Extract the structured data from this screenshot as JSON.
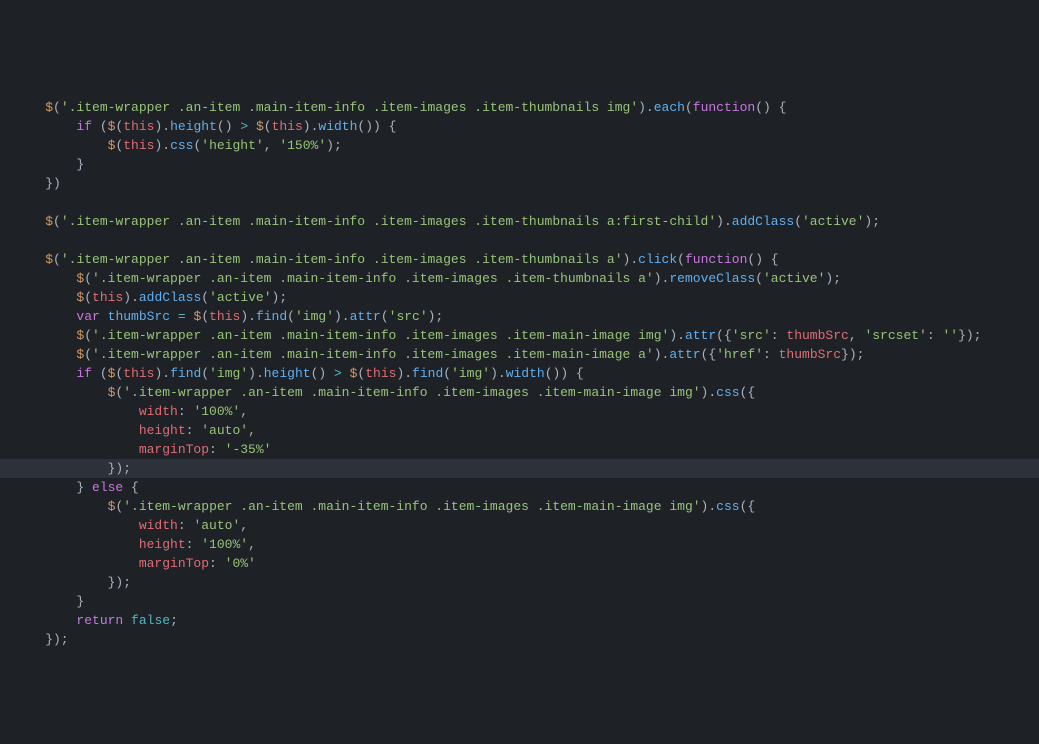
{
  "file": {
    "language": "javascript",
    "highlighted_line_index": 23
  },
  "code": {
    "tokens": [
      [
        [
          "w",
          "    $"
        ],
        [
          "p",
          "("
        ],
        [
          "s",
          "'.item-wrapper .an-item .main-item-info .item-images .item-thumbnails img'"
        ],
        [
          "p",
          ")."
        ],
        [
          "f",
          "each"
        ],
        [
          "p",
          "("
        ],
        [
          "k",
          "function"
        ],
        [
          "p",
          "() {"
        ]
      ],
      [
        [
          "p",
          "        "
        ],
        [
          "k",
          "if"
        ],
        [
          "p",
          " ("
        ],
        [
          "w",
          "$"
        ],
        [
          "p",
          "("
        ],
        [
          "v",
          "this"
        ],
        [
          "p",
          ")."
        ],
        [
          "f",
          "height"
        ],
        [
          "p",
          "() "
        ],
        [
          "o",
          ">"
        ],
        [
          "p",
          " "
        ],
        [
          "w",
          "$"
        ],
        [
          "p",
          "("
        ],
        [
          "v",
          "this"
        ],
        [
          "p",
          ")."
        ],
        [
          "f",
          "width"
        ],
        [
          "p",
          "()) {"
        ]
      ],
      [
        [
          "p",
          "            "
        ],
        [
          "w",
          "$"
        ],
        [
          "p",
          "("
        ],
        [
          "v",
          "this"
        ],
        [
          "p",
          ")."
        ],
        [
          "f",
          "css"
        ],
        [
          "p",
          "("
        ],
        [
          "s",
          "'height'"
        ],
        [
          "p",
          ", "
        ],
        [
          "s",
          "'150%'"
        ],
        [
          "p",
          ");"
        ]
      ],
      [
        [
          "p",
          "        }"
        ]
      ],
      [
        [
          "p",
          "    })"
        ]
      ],
      [
        [
          "p",
          ""
        ]
      ],
      [
        [
          "p",
          "    "
        ],
        [
          "w",
          "$"
        ],
        [
          "p",
          "("
        ],
        [
          "s",
          "'.item-wrapper .an-item .main-item-info .item-images .item-thumbnails a:first-child'"
        ],
        [
          "p",
          ")."
        ],
        [
          "f",
          "addClass"
        ],
        [
          "p",
          "("
        ],
        [
          "s",
          "'active'"
        ],
        [
          "p",
          ");"
        ]
      ],
      [
        [
          "p",
          ""
        ]
      ],
      [
        [
          "p",
          "    "
        ],
        [
          "w",
          "$"
        ],
        [
          "p",
          "("
        ],
        [
          "s",
          "'.item-wrapper .an-item .main-item-info .item-images .item-thumbnails a'"
        ],
        [
          "p",
          ")."
        ],
        [
          "f",
          "click"
        ],
        [
          "p",
          "("
        ],
        [
          "k",
          "function"
        ],
        [
          "p",
          "() {"
        ]
      ],
      [
        [
          "p",
          "        "
        ],
        [
          "w",
          "$"
        ],
        [
          "p",
          "("
        ],
        [
          "s",
          "'.item-wrapper .an-item .main-item-info .item-images .item-thumbnails a'"
        ],
        [
          "p",
          ")."
        ],
        [
          "f",
          "removeClass"
        ],
        [
          "p",
          "("
        ],
        [
          "s",
          "'active'"
        ],
        [
          "p",
          ");"
        ]
      ],
      [
        [
          "p",
          "        "
        ],
        [
          "w",
          "$"
        ],
        [
          "p",
          "("
        ],
        [
          "v",
          "this"
        ],
        [
          "p",
          ")."
        ],
        [
          "f",
          "addClass"
        ],
        [
          "p",
          "("
        ],
        [
          "s",
          "'active'"
        ],
        [
          "p",
          ");"
        ]
      ],
      [
        [
          "p",
          "        "
        ],
        [
          "k",
          "var"
        ],
        [
          "p",
          " "
        ],
        [
          "f",
          "thumbSrc"
        ],
        [
          "p",
          " "
        ],
        [
          "o",
          "="
        ],
        [
          "p",
          " "
        ],
        [
          "w",
          "$"
        ],
        [
          "p",
          "("
        ],
        [
          "v",
          "this"
        ],
        [
          "p",
          ")."
        ],
        [
          "f",
          "find"
        ],
        [
          "p",
          "("
        ],
        [
          "s",
          "'img'"
        ],
        [
          "p",
          ")."
        ],
        [
          "f",
          "attr"
        ],
        [
          "p",
          "("
        ],
        [
          "s",
          "'src'"
        ],
        [
          "p",
          ");"
        ]
      ],
      [
        [
          "p",
          "        "
        ],
        [
          "w",
          "$"
        ],
        [
          "p",
          "("
        ],
        [
          "s",
          "'.item-wrapper .an-item .main-item-info .item-images .item-main-image img'"
        ],
        [
          "p",
          ")."
        ],
        [
          "f",
          "attr"
        ],
        [
          "p",
          "({"
        ],
        [
          "s",
          "'src'"
        ],
        [
          "p",
          ": "
        ],
        [
          "v",
          "thumbSrc"
        ],
        [
          "p",
          ", "
        ],
        [
          "s",
          "'srcset'"
        ],
        [
          "p",
          ": "
        ],
        [
          "s",
          "''"
        ],
        [
          "p",
          "});"
        ]
      ],
      [
        [
          "p",
          "        "
        ],
        [
          "w",
          "$"
        ],
        [
          "p",
          "("
        ],
        [
          "s",
          "'.item-wrapper .an-item .main-item-info .item-images .item-main-image a'"
        ],
        [
          "p",
          ")."
        ],
        [
          "f",
          "attr"
        ],
        [
          "p",
          "({"
        ],
        [
          "s",
          "'href'"
        ],
        [
          "p",
          ": "
        ],
        [
          "v",
          "thumbSrc"
        ],
        [
          "p",
          "});"
        ]
      ],
      [
        [
          "p",
          "        "
        ],
        [
          "k",
          "if"
        ],
        [
          "p",
          " ("
        ],
        [
          "w",
          "$"
        ],
        [
          "p",
          "("
        ],
        [
          "v",
          "this"
        ],
        [
          "p",
          ")."
        ],
        [
          "f",
          "find"
        ],
        [
          "p",
          "("
        ],
        [
          "s",
          "'img'"
        ],
        [
          "p",
          ")."
        ],
        [
          "f",
          "height"
        ],
        [
          "p",
          "() "
        ],
        [
          "o",
          ">"
        ],
        [
          "p",
          " "
        ],
        [
          "w",
          "$"
        ],
        [
          "p",
          "("
        ],
        [
          "v",
          "this"
        ],
        [
          "p",
          ")."
        ],
        [
          "f",
          "find"
        ],
        [
          "p",
          "("
        ],
        [
          "s",
          "'img'"
        ],
        [
          "p",
          ")."
        ],
        [
          "f",
          "width"
        ],
        [
          "p",
          "()) {"
        ]
      ],
      [
        [
          "p",
          "            "
        ],
        [
          "w",
          "$"
        ],
        [
          "p",
          "("
        ],
        [
          "s",
          "'.item-wrapper .an-item .main-item-info .item-images .item-main-image img'"
        ],
        [
          "p",
          ")."
        ],
        [
          "f",
          "css"
        ],
        [
          "p",
          "({"
        ]
      ],
      [
        [
          "p",
          "                "
        ],
        [
          "v",
          "width"
        ],
        [
          "p",
          ": "
        ],
        [
          "s",
          "'100%'"
        ],
        [
          "p",
          ","
        ]
      ],
      [
        [
          "p",
          "                "
        ],
        [
          "v",
          "height"
        ],
        [
          "p",
          ": "
        ],
        [
          "s",
          "'auto'"
        ],
        [
          "p",
          ","
        ]
      ],
      [
        [
          "p",
          "                "
        ],
        [
          "v",
          "marginTop"
        ],
        [
          "p",
          ": "
        ],
        [
          "s",
          "'-35%'"
        ]
      ],
      [
        [
          "p",
          "            });"
        ]
      ],
      [
        [
          "p",
          "        } "
        ],
        [
          "k",
          "else"
        ],
        [
          "p",
          " {"
        ]
      ],
      [
        [
          "p",
          "            "
        ],
        [
          "w",
          "$"
        ],
        [
          "p",
          "("
        ],
        [
          "s",
          "'.item-wrapper .an-item .main-item-info .item-images .item-main-image img'"
        ],
        [
          "p",
          ")."
        ],
        [
          "f",
          "css"
        ],
        [
          "p",
          "({"
        ]
      ],
      [
        [
          "p",
          "                "
        ],
        [
          "v",
          "width"
        ],
        [
          "p",
          ": "
        ],
        [
          "s",
          "'auto'"
        ],
        [
          "p",
          ","
        ]
      ],
      [
        [
          "p",
          "                "
        ],
        [
          "v",
          "height"
        ],
        [
          "p",
          ": "
        ],
        [
          "s",
          "'100%'"
        ],
        [
          "p",
          ","
        ]
      ],
      [
        [
          "p",
          "                "
        ],
        [
          "v",
          "marginTop"
        ],
        [
          "p",
          ": "
        ],
        [
          "s",
          "'0%'"
        ]
      ],
      [
        [
          "p",
          "            });"
        ]
      ],
      [
        [
          "p",
          "        }"
        ]
      ],
      [
        [
          "p",
          "        "
        ],
        [
          "k",
          "return"
        ],
        [
          "p",
          " "
        ],
        [
          "b",
          "false"
        ],
        [
          "p",
          ";"
        ]
      ],
      [
        [
          "p",
          "    });"
        ]
      ]
    ]
  }
}
